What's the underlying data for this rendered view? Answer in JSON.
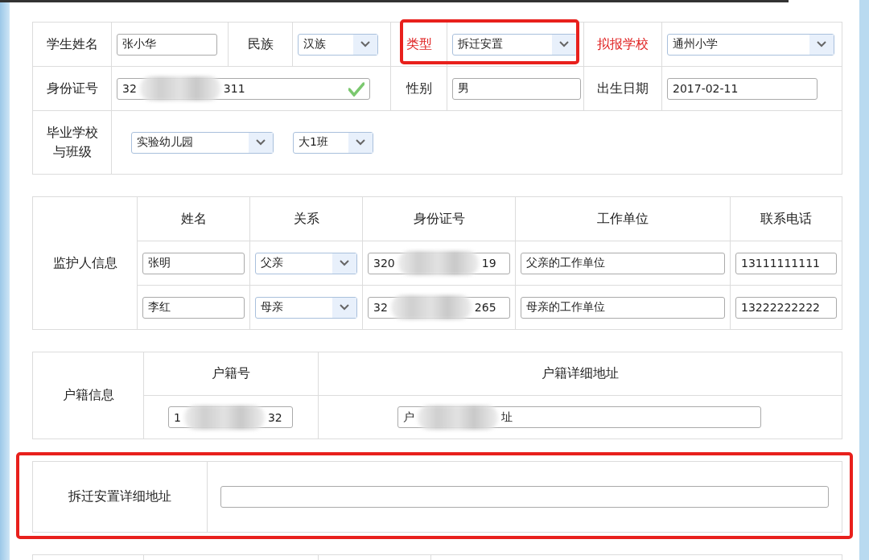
{
  "student": {
    "name": {
      "label": "学生姓名",
      "kind": "text",
      "value": "张小华"
    },
    "ethnicity": {
      "label": "民族",
      "kind": "select",
      "value": "汉族"
    },
    "type": {
      "label": "类型",
      "kind": "select",
      "value": "拆迁安置",
      "required": true,
      "highlighted": true
    },
    "school": {
      "label": "拟报学校",
      "kind": "select",
      "value": "通州小学",
      "required": true
    },
    "id_number": {
      "label": "身份证号",
      "kind": "redacted",
      "start": "32",
      "end": "311",
      "valid": true
    },
    "gender": {
      "label": "性别",
      "kind": "text",
      "value": "男"
    },
    "birth_date": {
      "label": "出生日期",
      "kind": "text",
      "value": "2017-02-11"
    },
    "graduation": {
      "label": "毕业学校与班级",
      "fields": [
        {
          "kind": "select",
          "value": "实验幼儿园"
        },
        {
          "kind": "select",
          "value": "大1班"
        }
      ]
    }
  },
  "guardians": {
    "label": "监护人信息",
    "columns": [
      "姓名",
      "关系",
      "身份证号",
      "工作单位",
      "联系电话"
    ],
    "rows": [
      [
        {
          "kind": "text",
          "value": "张明"
        },
        {
          "kind": "select",
          "value": "父亲"
        },
        {
          "kind": "redacted",
          "start": "320",
          "end": "19"
        },
        {
          "kind": "text",
          "value": "父亲的工作单位"
        },
        {
          "kind": "text",
          "value": "13111111111"
        }
      ],
      [
        {
          "kind": "text",
          "value": "李红"
        },
        {
          "kind": "select",
          "value": "母亲"
        },
        {
          "kind": "redacted",
          "start": "32",
          "end": "265"
        },
        {
          "kind": "text",
          "value": "母亲的工作单位"
        },
        {
          "kind": "text",
          "value": "13222222222"
        }
      ]
    ]
  },
  "household": {
    "label": "户籍信息",
    "columns": [
      "户籍号",
      "户籍详细地址"
    ],
    "row": [
      {
        "kind": "redacted",
        "start": "1",
        "end": "32"
      },
      {
        "kind": "redacted",
        "start": "户",
        "end": "址"
      }
    ]
  },
  "relocation": {
    "label": "拆迁安置详细地址",
    "highlighted": true,
    "field": {
      "kind": "text"
    }
  }
}
